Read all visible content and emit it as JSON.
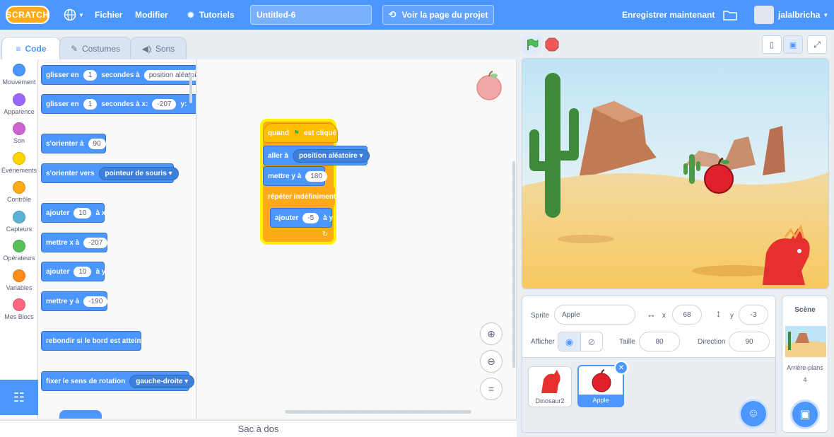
{
  "menubar": {
    "logo": "SCRATCH",
    "file": "Fichier",
    "edit": "Modifier",
    "tutorials": "Tutoriels",
    "project_title": "Untitled-6",
    "see_project_page": "Voir la page du projet",
    "save_now": "Enregistrer maintenant",
    "username": "jalalbricha"
  },
  "tabs": {
    "code": "Code",
    "costumes": "Costumes",
    "sounds": "Sons"
  },
  "categories": [
    {
      "label": "Mouvement",
      "color": "#4c97ff"
    },
    {
      "label": "Apparence",
      "color": "#9966ff"
    },
    {
      "label": "Son",
      "color": "#cf63cf"
    },
    {
      "label": "Événements",
      "color": "#ffd500"
    },
    {
      "label": "Contrôle",
      "color": "#ffab19"
    },
    {
      "label": "Capteurs",
      "color": "#5cb1d6"
    },
    {
      "label": "Opérateurs",
      "color": "#59c059"
    },
    {
      "label": "Variables",
      "color": "#ff8c1a"
    },
    {
      "label": "Mes Blocs",
      "color": "#ff6680"
    }
  ],
  "palette": {
    "glide1": {
      "a": "glisser en",
      "v": "1",
      "b": "secondes à",
      "d": "position aléatoire"
    },
    "glide2": {
      "a": "glisser en",
      "v": "1",
      "b": "secondes à x:",
      "x": "-207",
      "c": "y:"
    },
    "point_dir": {
      "a": "s'orienter à",
      "v": "90"
    },
    "point_towards": {
      "a": "s'orienter vers",
      "d": "pointeur de souris"
    },
    "change_x": {
      "a": "ajouter",
      "v": "10",
      "b": "à x"
    },
    "set_x": {
      "a": "mettre x à",
      "v": "-207"
    },
    "change_y": {
      "a": "ajouter",
      "v": "10",
      "b": "à y"
    },
    "set_y": {
      "a": "mettre y à",
      "v": "-190"
    },
    "bounce": {
      "a": "rebondir si le bord est atteint"
    },
    "rotation": {
      "a": "fixer le sens de rotation",
      "d": "gauche-droite"
    }
  },
  "script": {
    "hat": {
      "a": "quand",
      "b": "est cliqué"
    },
    "goto": {
      "a": "aller à",
      "d": "position aléatoire"
    },
    "sety": {
      "a": "mettre y à",
      "v": "180"
    },
    "forever": {
      "a": "répéter indéfiniment"
    },
    "changey": {
      "a": "ajouter",
      "v": "-5",
      "b": "à y"
    }
  },
  "backpack": "Sac à dos",
  "sprite_info": {
    "sprite_label": "Sprite",
    "sprite_name": "Apple",
    "x_label": "x",
    "x_value": "68",
    "y_label": "y",
    "y_value": "-3",
    "show_label": "Afficher",
    "size_label": "Taille",
    "size_value": "80",
    "direction_label": "Direction",
    "direction_value": "90"
  },
  "sprites": [
    {
      "name": "Dinosaur2",
      "selected": false
    },
    {
      "name": "Apple",
      "selected": true
    }
  ],
  "scene": {
    "title": "Scène",
    "backdrops_label": "Arrière-plans",
    "backdrops_count": "4"
  },
  "colors": {
    "menubar": "#4c97ff",
    "motion": "#4c97ff",
    "events": "#ffbf00",
    "control": "#ffab19"
  }
}
